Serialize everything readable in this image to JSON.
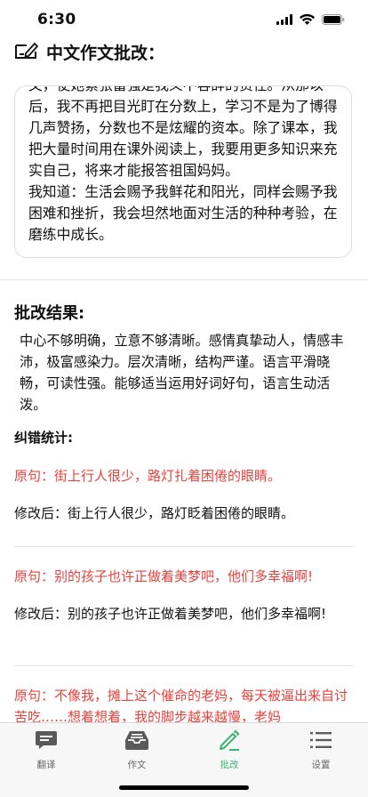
{
  "status": {
    "time": "6:30"
  },
  "header": {
    "title": "中文作文批改："
  },
  "essay": {
    "text": "文，使她紧张富强是我义不容辞的责任。从那以后，我不再把目光盯在分数上，学习不是为了博得几声赞扬，分数也不是炫耀的资本。除了课本，我把大量时间用在课外阅读上，我要用更多知识来充实自己，将来才能报答祖国妈妈。\n我知道：生活会赐予我鲜花和阳光，同样会赐予我困难和挫折，我会坦然地面对生活的种种考验，在磨练中成长。"
  },
  "result": {
    "title": "批改结果:",
    "text": "中心不够明确，立意不够清晰。感情真挚动人，情感丰沛，极富感染力。层次清晰，结构严谨。语言平滑晓畅，可读性强。能够适当运用好词好句，语言生动活泼。"
  },
  "stats": {
    "title": "纠错统计:",
    "items": [
      {
        "original": "原句：街上行人很少，路灯扎着困倦的眼睛。",
        "modified": "修改后：街上行人很少，路灯眨着困倦的眼睛。"
      },
      {
        "original": "原句：别的孩子也许正做着美梦吧，他们多幸福啊!",
        "modified": "修改后：别的孩子也许正做着美梦吧，他们多幸福啊!"
      },
      {
        "original": "原句：不像我，摊上这个催命的老妈，每天被逼出来自讨苦吃……想着想着，我的脚步越来越慢，老妈"
      }
    ]
  },
  "tabs": [
    {
      "label": "翻译",
      "icon": "chat-bubble-icon"
    },
    {
      "label": "作文",
      "icon": "inbox-tray-icon"
    },
    {
      "label": "批改",
      "icon": "pencil-icon",
      "active": true
    },
    {
      "label": "设置",
      "icon": "list-icon"
    }
  ],
  "colors": {
    "accent": "#3cb371",
    "error": "#e8423d",
    "tab_inactive": "#666666"
  }
}
